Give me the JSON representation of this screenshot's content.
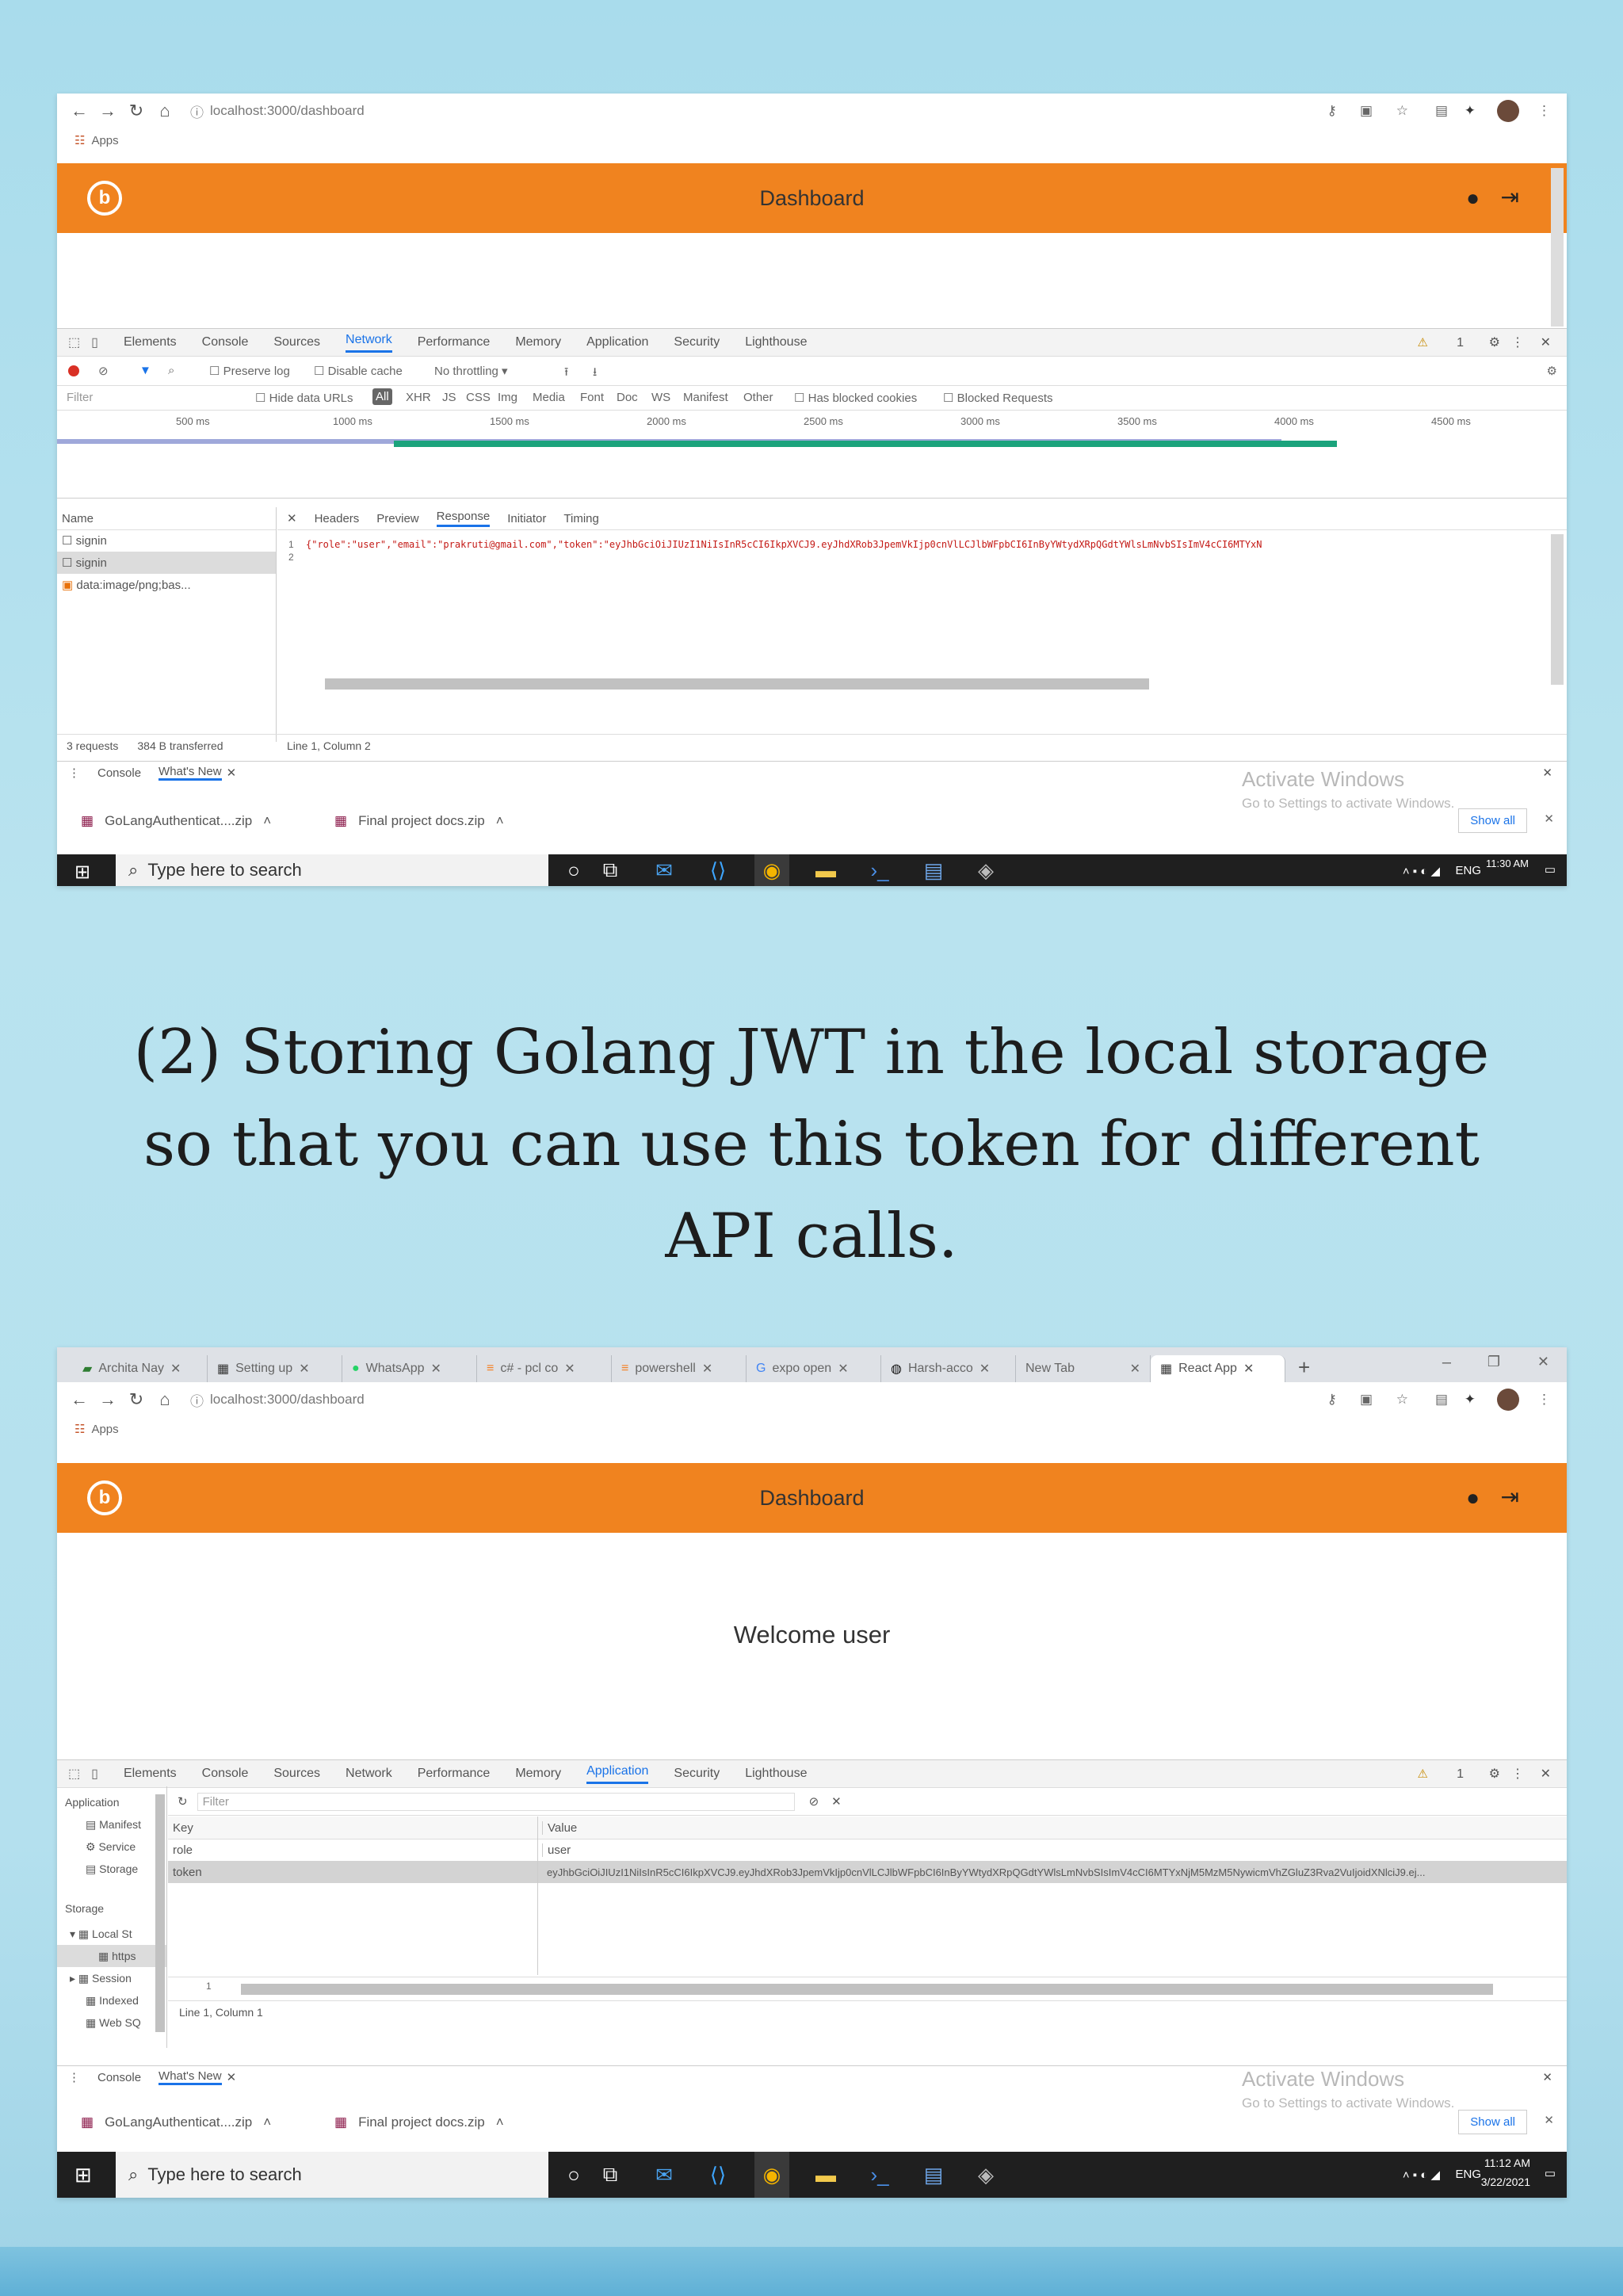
{
  "colors": {
    "orange": "#f0831f",
    "background": "#b4e0ee",
    "accent": "#1a73e8",
    "taskbar": "#1f1f1f"
  },
  "shot1": {
    "url": "localhost:3000/dashboard",
    "bookmark": "Apps",
    "header_title": "Dashboard",
    "devtools_tabs": [
      "Elements",
      "Console",
      "Sources",
      "Network",
      "Performance",
      "Memory",
      "Application",
      "Security",
      "Lighthouse"
    ],
    "active_tab": "Network",
    "network_toolbar": {
      "preserve_log": "Preserve log",
      "disable_cache": "Disable cache",
      "throttling": "No throttling"
    },
    "filter": {
      "placeholder": "Filter",
      "hide_data_urls": "Hide data URLs",
      "types": [
        "All",
        "XHR",
        "JS",
        "CSS",
        "Img",
        "Media",
        "Font",
        "Doc",
        "WS",
        "Manifest",
        "Other"
      ],
      "has_blocked_cookies": "Has blocked cookies",
      "blocked_requests": "Blocked Requests"
    },
    "timeline_ticks": [
      "500 ms",
      "1000 ms",
      "1500 ms",
      "2000 ms",
      "2500 ms",
      "3000 ms",
      "3500 ms",
      "4000 ms",
      "4500 ms"
    ],
    "name_header": "Name",
    "requests": [
      "signin",
      "signin",
      "data:image/png;bas..."
    ],
    "detail_tabs": [
      "Headers",
      "Preview",
      "Response",
      "Initiator",
      "Timing"
    ],
    "response_line": "{\"role\":\"user\",\"email\":\"prakruti@gmail.com\",\"token\":\"eyJhbGciOiJIUzI1NiIsInR5cCI6IkpXVCJ9.eyJhdXRob3JpemVkIjp0cnVlLCJlbWFpbCI6InByYWtydXRpQGdtYWlsLmNvbSIsImV4cCI6MTYxN",
    "status_left": "3 requests",
    "status_transferred": "384 B transferred",
    "status_right": "Line 1, Column 2",
    "warning_count": "1",
    "drawer_tabs": [
      "Console",
      "What's New"
    ],
    "downloads": [
      "GoLangAuthenticat....zip",
      "Final project docs.zip"
    ],
    "show_all": "Show all",
    "activate_title": "Activate Windows",
    "activate_sub": "Go to Settings to activate Windows.",
    "search_placeholder": "Type here to search",
    "tray_lang": "ENG",
    "time": "11:30 AM"
  },
  "caption": "(2) Storing Golang JWT in the local storage so that you can use this token for different API calls.",
  "shot2": {
    "tabs": [
      "Archita Nay",
      "Setting up",
      "WhatsApp",
      "c# - pcl co",
      "powershell",
      "expo open",
      "Harsh-acco",
      "New Tab",
      "React App"
    ],
    "url": "localhost:3000/dashboard",
    "bookmark": "Apps",
    "header_title": "Dashboard",
    "welcome": "Welcome user",
    "devtools_tabs": [
      "Elements",
      "Console",
      "Sources",
      "Network",
      "Performance",
      "Memory",
      "Application",
      "Security",
      "Lighthouse"
    ],
    "active_tab": "Application",
    "filter_placeholder": "Filter",
    "sidebar": {
      "application_header": "Application",
      "items": [
        "Manifest",
        "Service",
        "Storage"
      ],
      "storage_header": "Storage",
      "storage_items": [
        "Local St",
        "https",
        "Session",
        "Indexed",
        "Web SQ"
      ]
    },
    "table": {
      "key_header": "Key",
      "value_header": "Value",
      "rows": [
        {
          "key": "role",
          "value": "user"
        },
        {
          "key": "token",
          "value": "eyJhbGciOiJIUzI1NiIsInR5cCI6IkpXVCJ9.eyJhdXRob3JpemVkIjp0cnVlLCJlbWFpbCI6InByYWtydXRpQGdtYWlsLmNvbSIsImV4cCI6MTYxNjM5MzM5NywicmVhZGluZ3Rva2VuIjoidXNlciJ9.ej..."
        }
      ]
    },
    "status_line": "Line 1, Column 1",
    "warning_count": "1",
    "drawer_tabs": [
      "Console",
      "What's New"
    ],
    "downloads": [
      "GoLangAuthenticat....zip",
      "Final project docs.zip"
    ],
    "show_all": "Show all",
    "activate_title": "Activate Windows",
    "activate_sub": "Go to Settings to activate Windows.",
    "search_placeholder": "Type here to search",
    "tray_lang": "ENG",
    "time": "11:12 AM",
    "date": "3/22/2021"
  }
}
